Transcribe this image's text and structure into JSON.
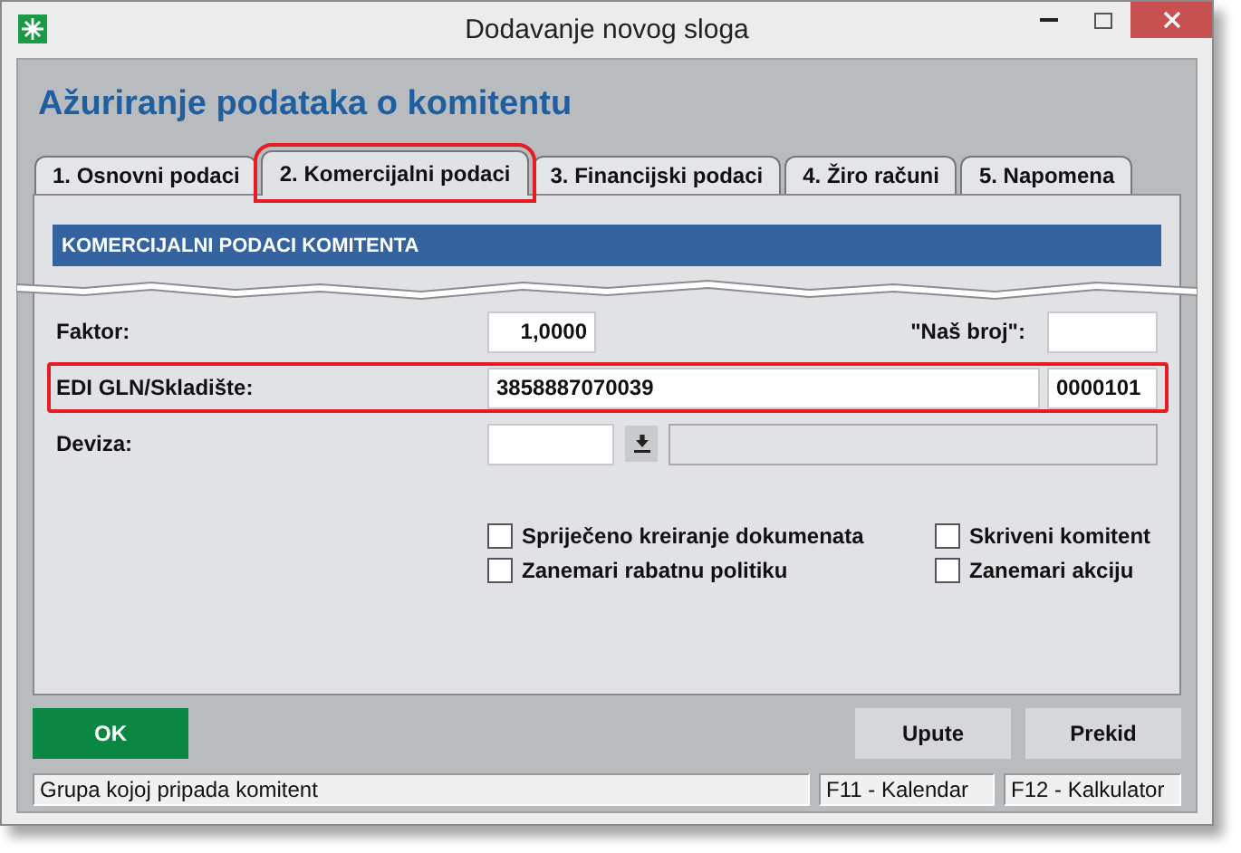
{
  "window": {
    "title": "Dodavanje novog sloga"
  },
  "heading": "Ažuriranje podataka o komitentu",
  "tabs": [
    {
      "label": "1. Osnovni podaci",
      "selected": false,
      "highlighted": false
    },
    {
      "label": "2. Komercijalni podaci",
      "selected": true,
      "highlighted": true
    },
    {
      "label": "3. Financijski podaci",
      "selected": false,
      "highlighted": false
    },
    {
      "label": "4. Žiro računi",
      "selected": false,
      "highlighted": false
    },
    {
      "label": "5. Napomena",
      "selected": false,
      "highlighted": false
    }
  ],
  "section_title": "KOMERCIJALNI PODACI KOMITENTA",
  "rows": [
    {
      "label": "Faktor:",
      "highlighted": false,
      "fields": [
        {
          "kind": "number",
          "value": "1,0000"
        },
        {
          "kind": "label",
          "text": "\"Naš broj\":"
        },
        {
          "kind": "small"
        }
      ]
    },
    {
      "label": "EDI GLN/Skladište:",
      "highlighted": true,
      "fields": [
        {
          "kind": "wide",
          "value": "3858887070039"
        },
        {
          "kind": "small",
          "value": "0000101"
        }
      ]
    },
    {
      "label": "Deviza:",
      "highlighted": false,
      "fields": [
        {
          "kind": "combo"
        },
        {
          "kind": "dropdown"
        },
        {
          "kind": "disabled"
        }
      ]
    }
  ],
  "checkboxes": [
    {
      "label": "Spriječeno kreiranje dokumenata",
      "checked": false
    },
    {
      "label": "Skriveni komitent",
      "checked": false
    },
    {
      "label": "Zanemari rabatnu politiku",
      "checked": false
    },
    {
      "label": "Zanemari akciju",
      "checked": false
    }
  ],
  "buttons": [
    {
      "label": "OK",
      "kind": "primary"
    },
    {
      "label": "Upute",
      "kind": "normal"
    },
    {
      "label": "Prekid",
      "kind": "normal"
    }
  ],
  "status_bar": {
    "hint": "Grupa kojoj pripada komitent",
    "keys": [
      "F11 - Kalendar",
      "F12 - Kalkulator"
    ]
  }
}
